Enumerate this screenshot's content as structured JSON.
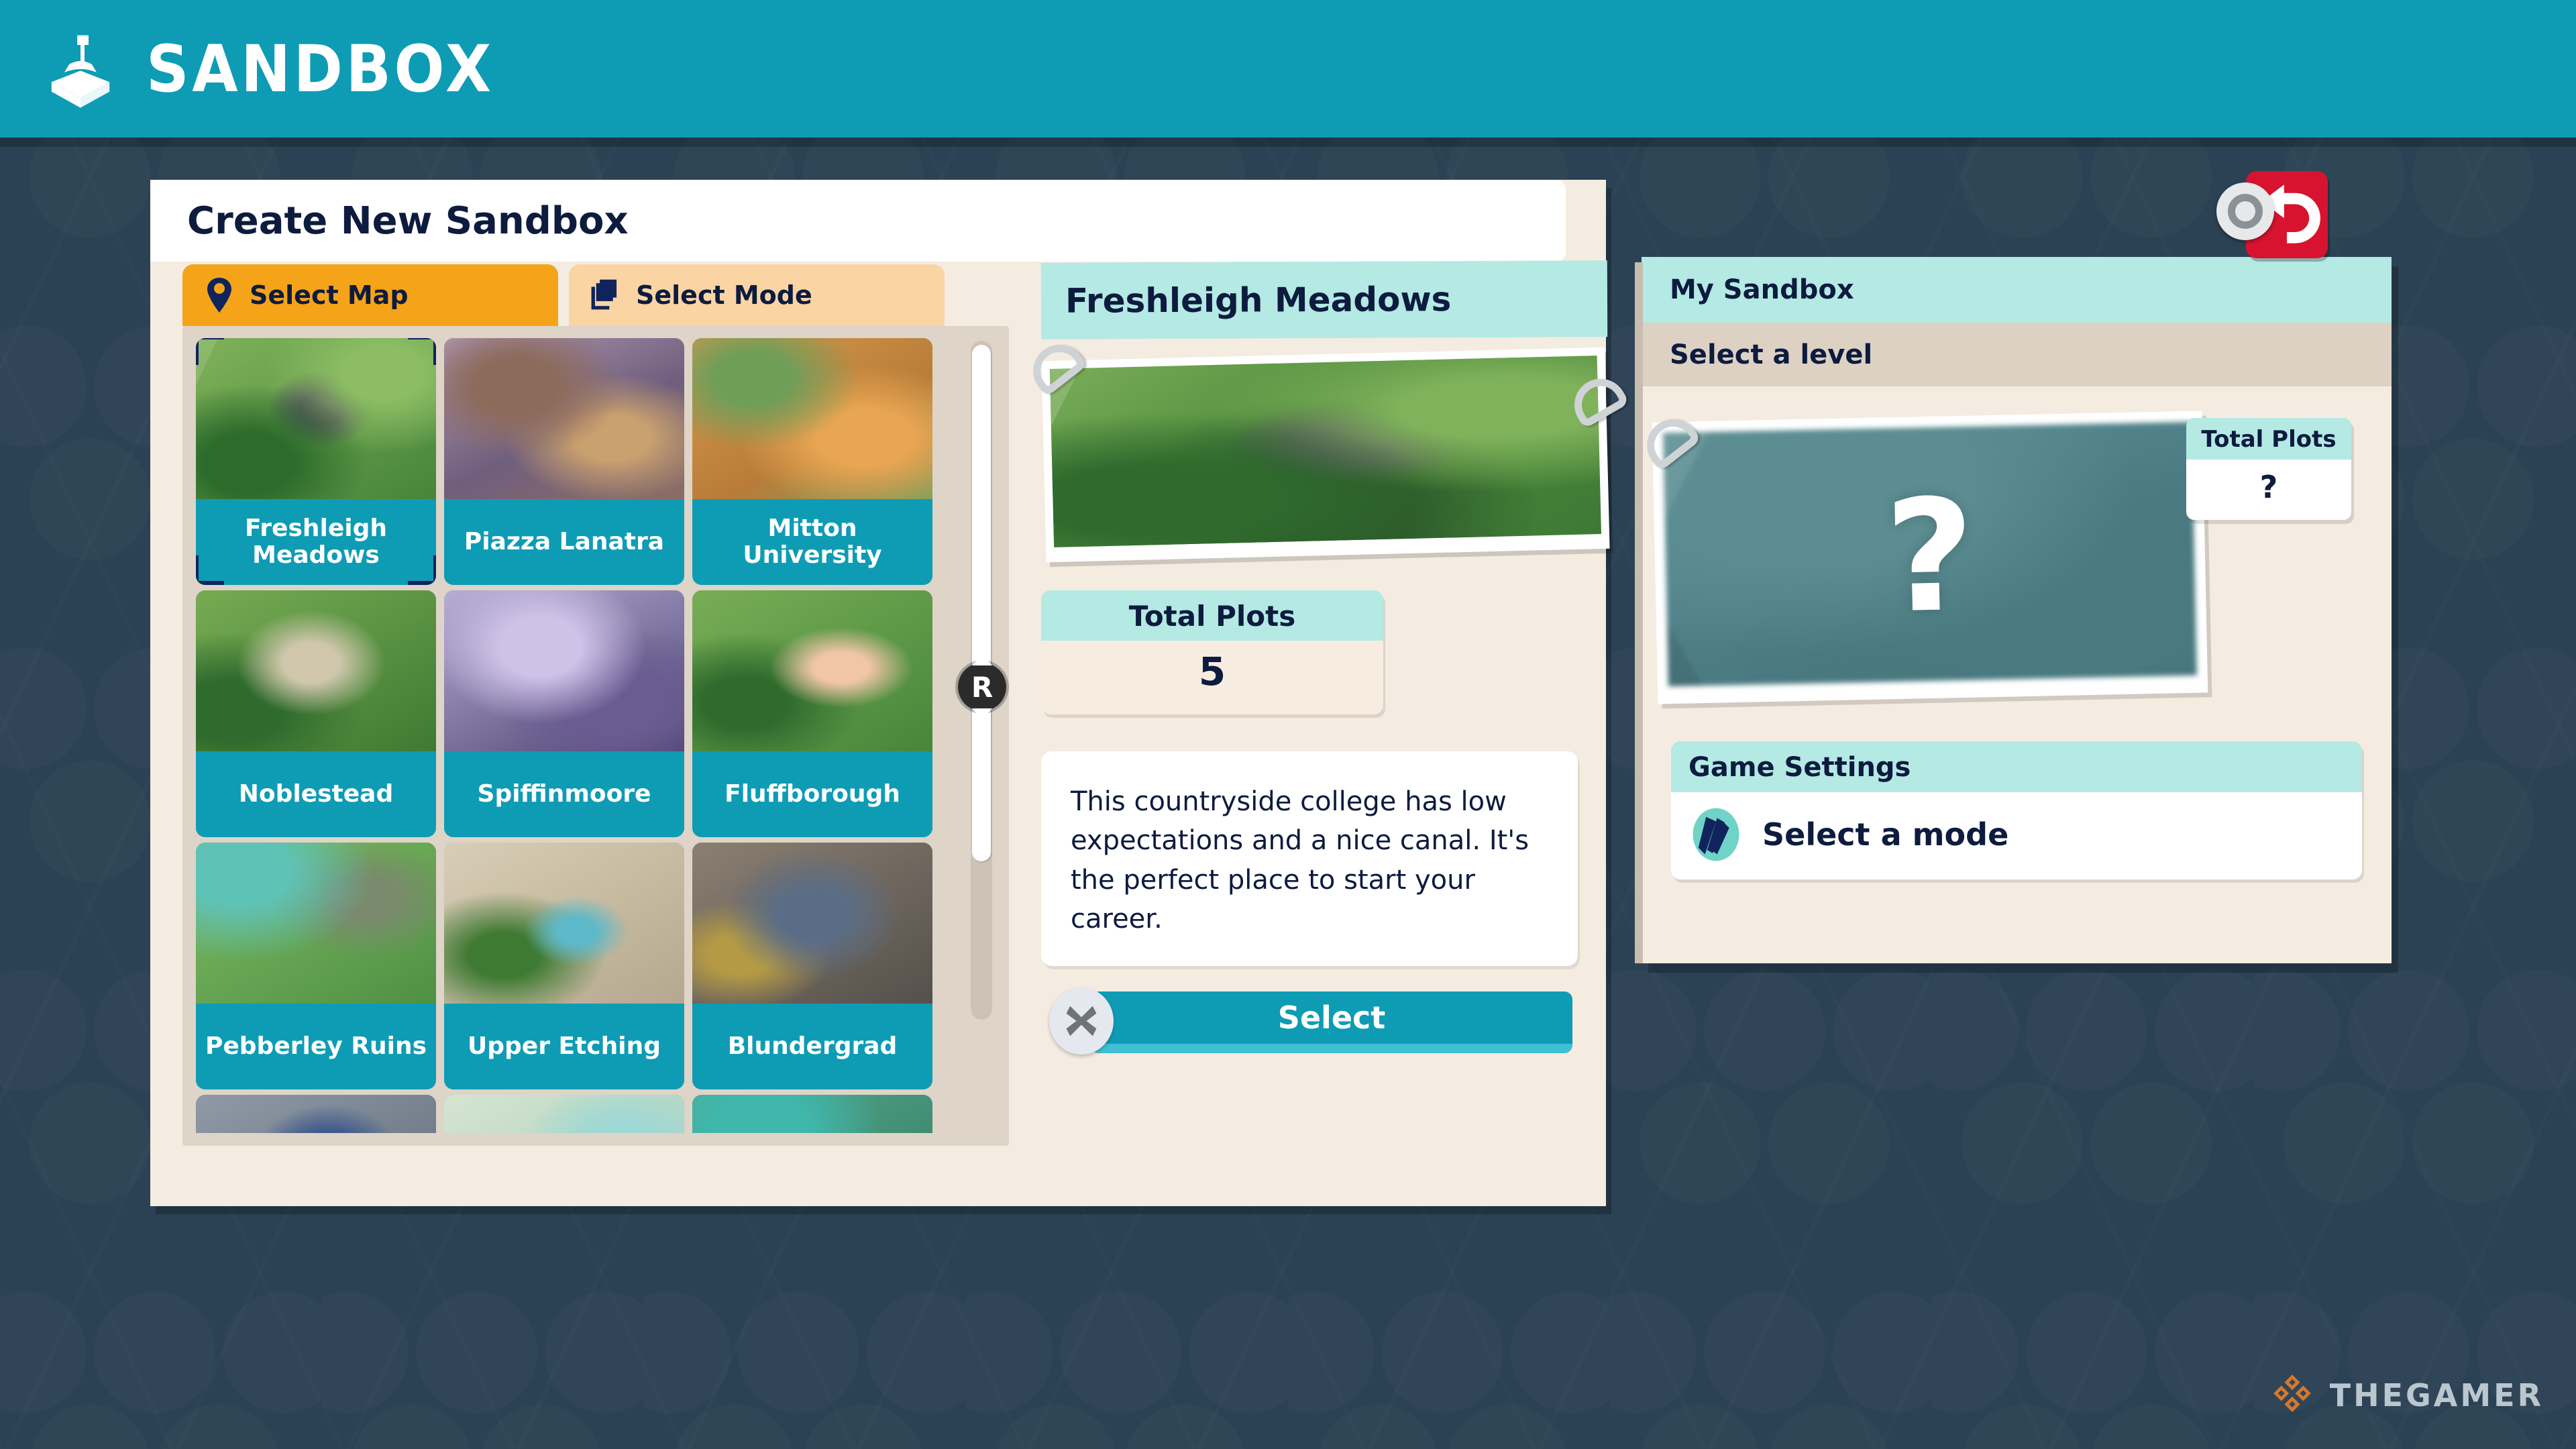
{
  "app": {
    "title": "SANDBOX",
    "logo_icon": "sandbox-shovel-box-icon",
    "header_color": "#0e9cb5",
    "background_color": "#2b4254"
  },
  "create_panel": {
    "title": "Create New Sandbox",
    "tabs": [
      {
        "label": "Select Map",
        "icon": "map-pin-icon",
        "active": true,
        "color": "#f5a318"
      },
      {
        "label": "Select Mode",
        "icon": "layers-icon",
        "active": false,
        "color": "#fbd4a4"
      }
    ],
    "maps": [
      {
        "name": "Freshleigh Meadows",
        "selected": true
      },
      {
        "name": "Piazza Lanatra",
        "selected": false
      },
      {
        "name": "Mitton University",
        "selected": false
      },
      {
        "name": "Noblestead",
        "selected": false
      },
      {
        "name": "Spiffinmoore",
        "selected": false
      },
      {
        "name": "Fluffborough",
        "selected": false
      },
      {
        "name": "Pebberley Ruins",
        "selected": false
      },
      {
        "name": "Upper Etching",
        "selected": false
      },
      {
        "name": "Blundergrad",
        "selected": false
      },
      {
        "name": "",
        "selected": false
      },
      {
        "name": "",
        "selected": false
      },
      {
        "name": "",
        "selected": false
      }
    ],
    "scroll_hint_button": "R"
  },
  "detail": {
    "map_name": "Freshleigh Meadows",
    "plots_label": "Total Plots",
    "plots_value": "5",
    "description": "This countryside college has low expectations and a nice canal. It's the perfect place to start your career.",
    "select_label": "Select",
    "close_icon": "close-x-icon"
  },
  "sandbox_summary": {
    "header": "My Sandbox",
    "level_status": "Select a level",
    "thumb_placeholder": "?",
    "plots_label": "Total Plots",
    "plots_value": "?",
    "game_settings_header": "Game Settings",
    "mode_label": "Select a mode",
    "mode_icon": "pencil-tools-icon"
  },
  "back_button": {
    "icon": "undo-arrow-icon",
    "gamepad_icon": "b-button-icon",
    "color": "#d7132f"
  },
  "watermark": {
    "text": "THEGAMER",
    "icon": "thegamer-logo-icon",
    "accent_color": "#e07b2a"
  }
}
